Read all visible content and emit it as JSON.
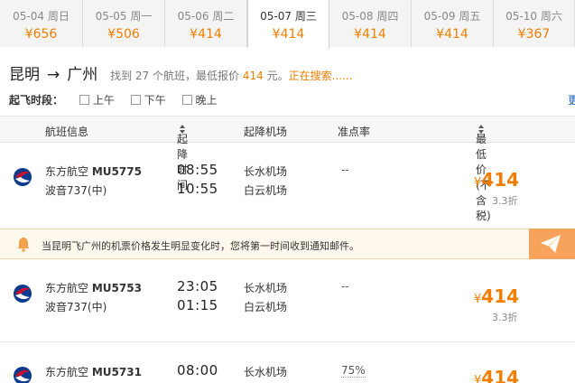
{
  "date_tabs": [
    {
      "date": "05-04 周日",
      "price": "¥656"
    },
    {
      "date": "05-05 周一",
      "price": "¥506"
    },
    {
      "date": "05-06 周二",
      "price": "¥414"
    },
    {
      "date": "05-07 周三",
      "price": "¥414"
    },
    {
      "date": "05-08 周四",
      "price": "¥414"
    },
    {
      "date": "05-09 周五",
      "price": "¥414"
    },
    {
      "date": "05-10 周六",
      "price": "¥367"
    }
  ],
  "route": {
    "from": "昆明",
    "arrow": "→",
    "to": "广州",
    "summary_prefix": "找到",
    "flight_count": "27",
    "summary_mid": "个航班，最低报价",
    "lowest_price": "414",
    "summary_suffix": "元。",
    "status": "正在搜索......"
  },
  "filters": {
    "label": "起飞时段：",
    "options": [
      "上午",
      "下午",
      "晚上"
    ],
    "more": "更"
  },
  "table_header": {
    "flight_info": "航班信息",
    "times": "起降时间",
    "airports": "起降机场",
    "ontime": "准点率",
    "lowest_price": "最低价(不含税)"
  },
  "flights": [
    {
      "airline": "东方航空",
      "flight_no": "MU5775",
      "aircraft": "波音737(中)",
      "dep_time": "08:55",
      "arr_time": "10:55",
      "dep_airport": "长水机场",
      "arr_airport": "白云机场",
      "ontime": "--",
      "currency": "¥",
      "price": "414",
      "discount": "3.3折"
    },
    {
      "airline": "东方航空",
      "flight_no": "MU5753",
      "aircraft": "波音737(中)",
      "dep_time": "23:05",
      "arr_time": "01:15",
      "dep_airport": "长水机场",
      "arr_airport": "白云机场",
      "ontime": "--",
      "currency": "¥",
      "price": "414",
      "discount": "3.3折"
    },
    {
      "airline": "东方航空",
      "flight_no": "MU5731",
      "dep_time": "08:00",
      "dep_airport": "长水机场",
      "ontime": "75%",
      "currency": "¥",
      "price": "414"
    }
  ],
  "notice": {
    "text": "当昆明飞广州的机票价格发生明显变化时，您将第一时间收到通知邮件。"
  },
  "colors": {
    "accent": "#f07e00",
    "airline_red": "#c8102e",
    "airline_blue": "#0b3b8c",
    "notice_bg": "#fff8ec",
    "notify_button": "#f7a35c"
  }
}
